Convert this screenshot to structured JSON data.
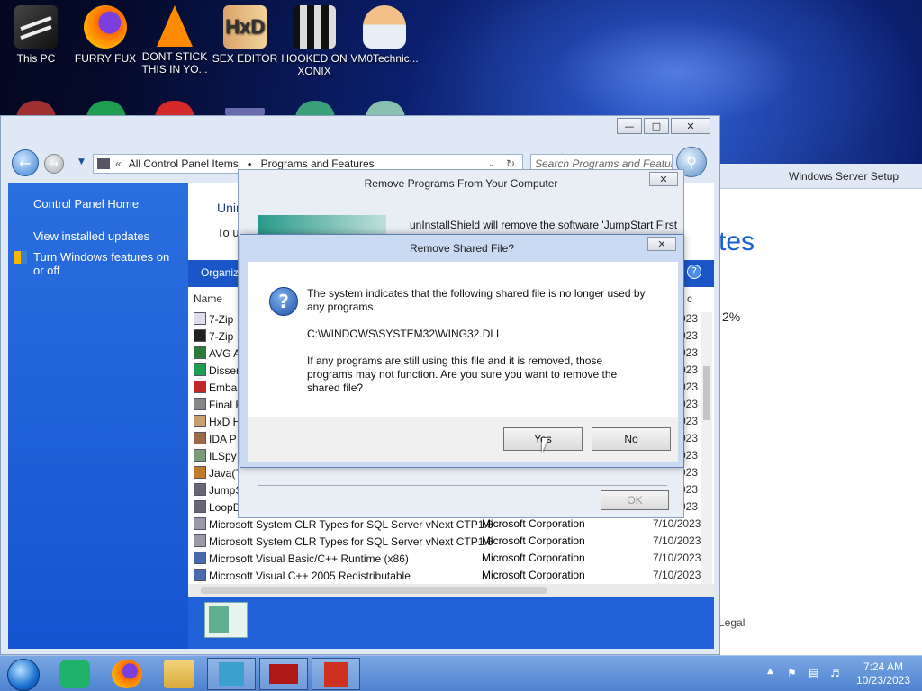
{
  "desktop": {
    "icons": [
      {
        "label": "This PC",
        "icon": "computer-icon"
      },
      {
        "label": "FURRY FUX",
        "icon": "firefox-icon"
      },
      {
        "label": "DONT STICK THIS IN YO...",
        "icon": "vlc-icon"
      },
      {
        "label": "SEX EDITOR",
        "icon": "hex-editor-icon"
      },
      {
        "label": "HOOKED ON XONIX",
        "icon": "game-icon"
      },
      {
        "label": "VM0Technic...",
        "icon": "user-icon"
      }
    ]
  },
  "explorer": {
    "address": {
      "back_icon": "back-arrow-icon",
      "segments": [
        "All Control Panel Items",
        "Programs and Features"
      ]
    },
    "search_placeholder": "Search Programs and Features",
    "sidebar": {
      "items": [
        "Control Panel Home",
        "View installed updates",
        "Turn Windows features on or off"
      ]
    },
    "content": {
      "heading_partial": "Unin",
      "subheading_partial": "To u",
      "toolbar_organize": "Organiz",
      "column_name": "Name",
      "column_installed_partial": "d c",
      "rows": [
        {
          "name": "7-Zip",
          "publisher": "",
          "date": "2023"
        },
        {
          "name": "7-Zip",
          "publisher": "",
          "date": "2023"
        },
        {
          "name": "AVG A",
          "publisher": "",
          "date": "023"
        },
        {
          "name": "Dissen",
          "publisher": "",
          "date": "2023"
        },
        {
          "name": "Emba",
          "publisher": "",
          "date": "2023"
        },
        {
          "name": "Final F",
          "publisher": "",
          "date": "2023"
        },
        {
          "name": "HxD H",
          "publisher": "",
          "date": "2023"
        },
        {
          "name": "IDA P",
          "publisher": "",
          "date": "2023"
        },
        {
          "name": "ILSpy",
          "publisher": "",
          "date": "2023"
        },
        {
          "name": "Java(T",
          "publisher": "",
          "date": "2023"
        },
        {
          "name": "JumpS",
          "publisher": "",
          "date": "2023"
        },
        {
          "name": "LoopB",
          "publisher": "",
          "date": "2023"
        },
        {
          "name": "Microsoft System CLR Types for SQL Server vNext CTP1.6",
          "publisher": "Microsoft Corporation",
          "date": "7/10/2023"
        },
        {
          "name": "Microsoft System CLR Types for SQL Server vNext CTP1.6",
          "publisher": "Microsoft Corporation",
          "date": "7/10/2023"
        },
        {
          "name": "Microsoft Visual Basic/C++ Runtime (x86)",
          "publisher": "Microsoft Corporation",
          "date": "7/10/2023"
        },
        {
          "name": "Microsoft Visual C++ 2005 Redistributable",
          "publisher": "Microsoft Corporation",
          "date": "7/10/2023"
        }
      ]
    }
  },
  "setup_window": {
    "title": "Windows Server Setup",
    "text_partial": "tes",
    "percent_partial": "2%",
    "legal": "Legal"
  },
  "uninstall_dialog": {
    "title": "Remove Programs From Your Computer",
    "text": "unInstallShield will remove the software 'JumpStart First",
    "ok": "OK"
  },
  "confirm_dialog": {
    "title": "Remove Shared File?",
    "line1": "The system indicates that the following shared file is no longer used by",
    "line1b": "any programs.",
    "path": "C:\\WINDOWS\\SYSTEM32\\WING32.DLL",
    "line2": "If any programs are still using this file and it is removed, those",
    "line2b": "programs may not function.  Are you sure you want to remove the",
    "line2c": "shared file?",
    "yes": "Yes",
    "no": "No"
  },
  "taskbar": {
    "time": "7:24 AM",
    "date": "10/23/2023"
  }
}
